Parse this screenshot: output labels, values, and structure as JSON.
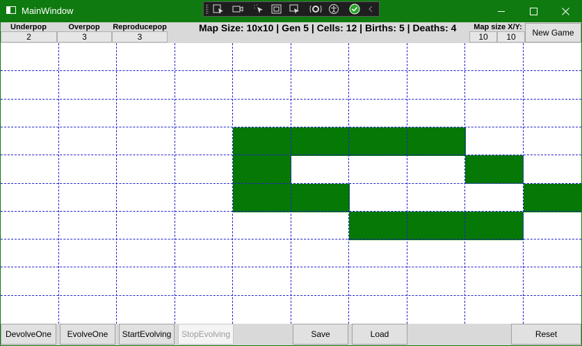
{
  "window": {
    "title": "MainWindow",
    "accent_color": "#0f7a0f"
  },
  "debug_toolbar": {
    "icons": [
      "select-element-icon",
      "video-icon",
      "pointer-icon",
      "layout-box-icon",
      "track-focus-icon",
      "hot-reload-icon",
      "accessibility-icon",
      "checked-icon",
      "collapse-chevron-icon"
    ]
  },
  "params": {
    "underpop_label": "Underpop",
    "underpop_value": "2",
    "overpop_label": "Overpop",
    "overpop_value": "3",
    "reproducepop_label": "Reproducepop",
    "reproducepop_value": "3"
  },
  "status_text": "Map Size: 10x10 | Gen 5 | Cells: 12 | Births: 5 | Deaths: 4",
  "map_size": {
    "label": "Map size X/Y:",
    "x": "10",
    "y": "10"
  },
  "new_game_label": "New Game",
  "grid": {
    "cols": 10,
    "rows": 10,
    "alive_color": "#067806",
    "alive_cells": [
      [
        3,
        4
      ],
      [
        3,
        5
      ],
      [
        3,
        6
      ],
      [
        3,
        7
      ],
      [
        4,
        4
      ],
      [
        4,
        8
      ],
      [
        5,
        4
      ],
      [
        5,
        5
      ],
      [
        5,
        9
      ],
      [
        6,
        6
      ],
      [
        6,
        7
      ],
      [
        6,
        8
      ]
    ]
  },
  "bottom_buttons": {
    "devolve_one": "DevolveOne",
    "evolve_one": "EvolveOne",
    "start_evolving": "StartEvolving",
    "stop_evolving": "StopEvolving",
    "save": "Save",
    "load": "Load",
    "reset": "Reset"
  }
}
